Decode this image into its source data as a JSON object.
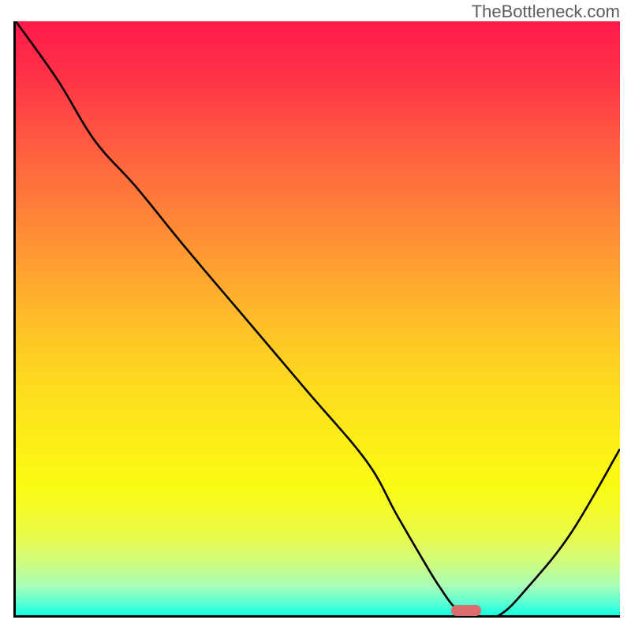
{
  "watermark_text": "TheBottleneck.com",
  "chart_data": {
    "type": "line",
    "title": "",
    "xlabel": "",
    "ylabel": "",
    "xlim": [
      0,
      100
    ],
    "ylim": [
      0,
      100
    ],
    "series": [
      {
        "name": "bottleneck-curve",
        "x": [
          0,
          7,
          13,
          20,
          28,
          38,
          48,
          58,
          63,
          67,
          70,
          73,
          76,
          80,
          85,
          92,
          100
        ],
        "y": [
          100,
          90,
          80,
          72,
          62,
          50,
          38,
          26,
          17,
          10,
          5,
          1,
          0,
          0,
          5,
          14,
          28
        ],
        "note": "y=0 is the baseline (green); y=100 is the top (red). Curve descends from top-left, flattens near x≈73–80 at the bottom, then rises to the right."
      }
    ],
    "marker": {
      "x_center_pct": 74.5,
      "y_pct": 0,
      "color": "#dc6c6e",
      "shape": "rounded-rect"
    },
    "gradient": {
      "stops": [
        {
          "pos": 0,
          "color": "#ff1b4b"
        },
        {
          "pos": 50,
          "color": "#febc29"
        },
        {
          "pos": 78,
          "color": "#fbfa11"
        },
        {
          "pos": 100,
          "color": "#12ffe2"
        }
      ]
    }
  }
}
